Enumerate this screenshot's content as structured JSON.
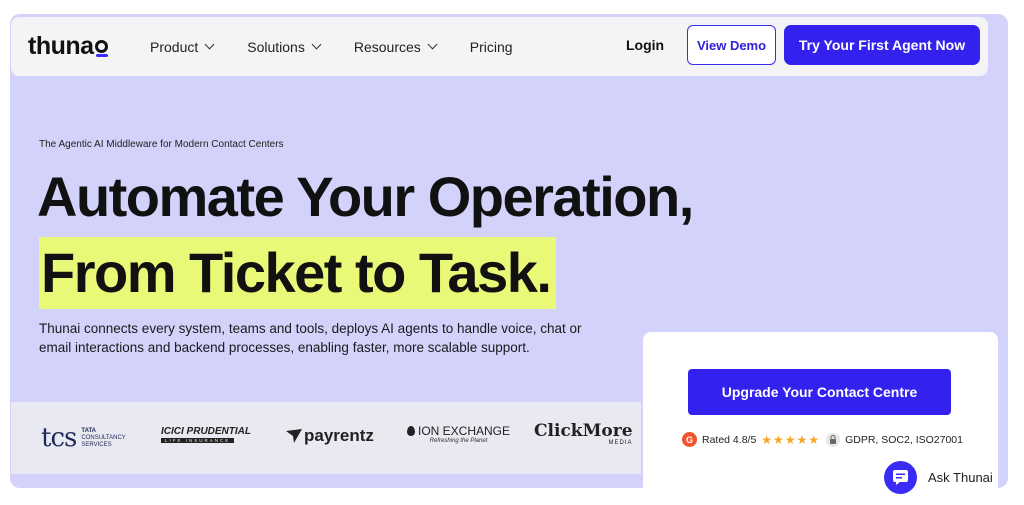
{
  "nav": {
    "logo": "thuna",
    "menu": [
      {
        "label": "Product",
        "has_dropdown": true
      },
      {
        "label": "Solutions",
        "has_dropdown": true
      },
      {
        "label": "Resources",
        "has_dropdown": true
      },
      {
        "label": "Pricing",
        "has_dropdown": false
      }
    ],
    "login": "Login",
    "view_demo": "View Demo",
    "try_agent": "Try Your First Agent Now"
  },
  "hero": {
    "eyebrow": "The Agentic AI Middleware for Modern Contact Centers",
    "headline_line1": "Automate Your Operation,",
    "headline_line2": "From Ticket to Task.",
    "description": "Thunai connects every system, teams and tools, deploys AI agents to handle voice, chat or email interactions and backend processes, enabling faster, more scalable support."
  },
  "client_logos": [
    {
      "name": "TCS",
      "mark": "tcs",
      "line1": "TATA",
      "line2": "CONSULTANCY",
      "line3": "SERVICES"
    },
    {
      "name": "ICICI Prudential",
      "mark": "ICICI PRUDENTIAL",
      "sub": "LIFE INSURANCE"
    },
    {
      "name": "payrentz",
      "mark": "payrentz"
    },
    {
      "name": "Ion Exchange",
      "mark": "ION EXCHANGE",
      "sub": "Refreshing the Planet"
    },
    {
      "name": "ClickMore Media",
      "mark": "ClickMore",
      "sub": "MEDIA"
    }
  ],
  "cta": {
    "button": "Upgrade Your Contact Centre",
    "rating_text": "Rated 4.8/5",
    "stars": "★★★★★",
    "compliance": "GDPR, SOC2, ISO27001"
  },
  "chat": {
    "label": "Ask Thunai"
  },
  "colors": {
    "hero_bg": "#d3d2fb",
    "accent": "#3322ee",
    "highlight": "#e9f876",
    "star": "#f5a623"
  },
  "icons": [
    "chevron-down-icon",
    "g2-icon",
    "star-icon",
    "lock-icon",
    "chat-icon"
  ]
}
